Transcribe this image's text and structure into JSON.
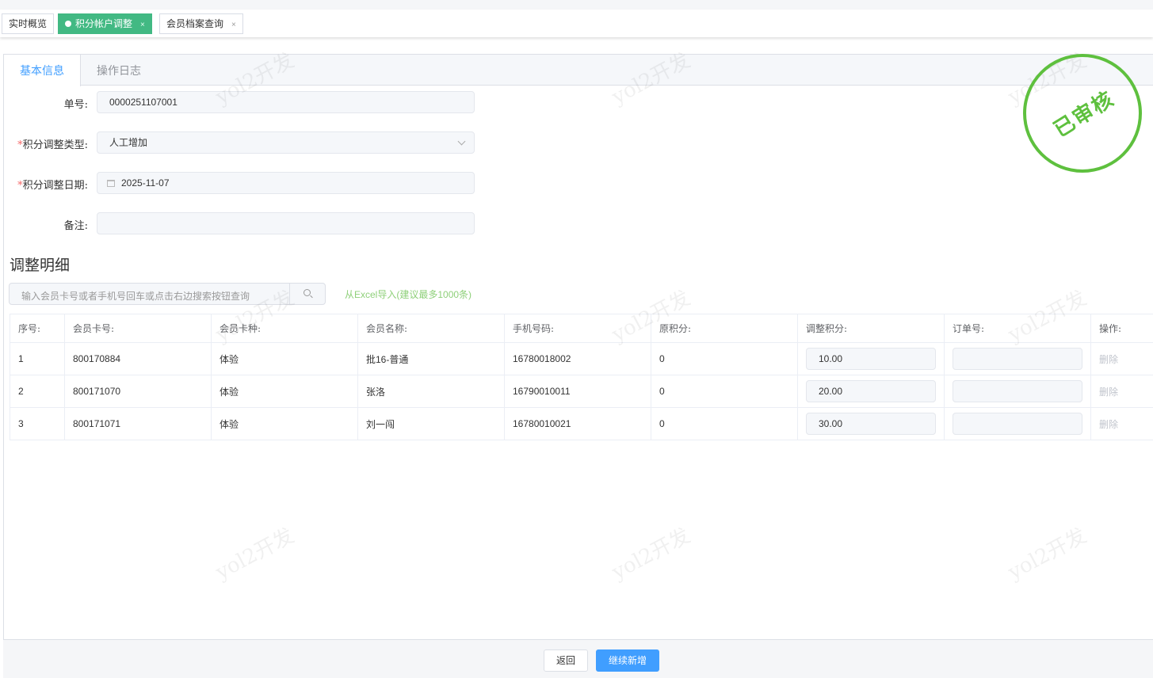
{
  "page_tabs": [
    {
      "label": "实时概览"
    },
    {
      "label": "积分帐户调整",
      "active": true
    },
    {
      "label": "会员档案查询"
    }
  ],
  "close_glyph": "×",
  "form_tabs": {
    "basic": "基本信息",
    "log": "操作日志"
  },
  "form": {
    "order_no": {
      "label": "单号:",
      "value": "0000251107001"
    },
    "type": {
      "label": "积分调整类型:",
      "value": "人工增加",
      "required": "*"
    },
    "date": {
      "label": "积分调整日期:",
      "value": "2025-11-07",
      "required": "*"
    },
    "remark": {
      "label": "备注:",
      "value": ""
    }
  },
  "section_title": "调整明细",
  "search": {
    "placeholder": "输入会员卡号或者手机号回车或点击右边搜索按钮查询"
  },
  "excel_link": "从Excel导入(建议最多1000条)",
  "table": {
    "headers": [
      "序号:",
      "会员卡号:",
      "会员卡种:",
      "会员名称:",
      "手机号码:",
      "原积分:",
      "调整积分:",
      "订单号:",
      "操作:"
    ],
    "rows": [
      {
        "no": "1",
        "card": "800170884",
        "type": "体验",
        "name": "批16-普通",
        "phone": "16780018002",
        "orig": "0",
        "adjust": "10.00",
        "order": "",
        "action": "删除"
      },
      {
        "no": "2",
        "card": "800171070",
        "type": "体验",
        "name": "张洛",
        "phone": "16790010011",
        "orig": "0",
        "adjust": "20.00",
        "order": "",
        "action": "删除"
      },
      {
        "no": "3",
        "card": "800171071",
        "type": "体验",
        "name": "刘一闯",
        "phone": "16780010021",
        "orig": "0",
        "adjust": "30.00",
        "order": "",
        "action": "删除"
      }
    ]
  },
  "stamp": "已审核",
  "watermark": "yol2开发",
  "footer": {
    "back": "返回",
    "continue": "继续新增"
  },
  "colors": {
    "accent": "#409eff",
    "active_tab": "#42b983",
    "stamp": "#5ec03e"
  }
}
